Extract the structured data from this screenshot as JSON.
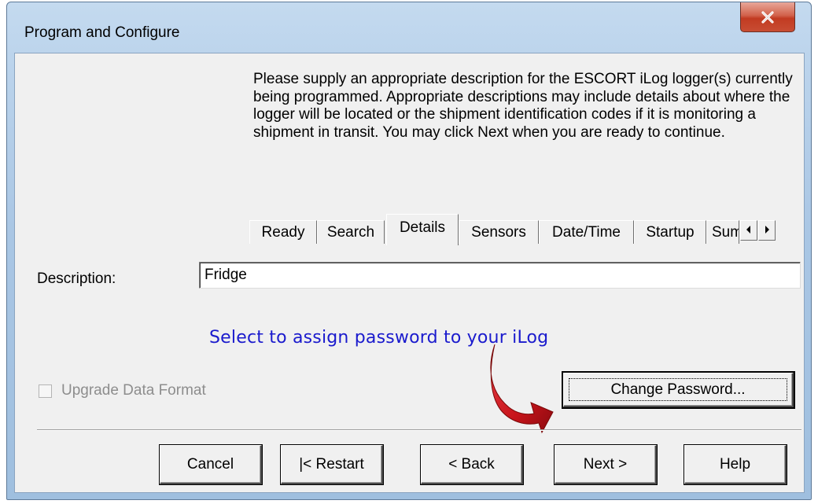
{
  "window": {
    "title": "Program and Configure",
    "close_label": "close"
  },
  "instructions": "Please supply an appropriate description for the ESCORT iLog logger(s) currently being programmed. Appropriate descriptions may include details about where the logger will be located or the shipment identification codes if it is monitoring a shipment in transit. You may click Next when you are ready to continue.",
  "tabs": [
    {
      "label": "Ready",
      "active": false
    },
    {
      "label": "Search",
      "active": false
    },
    {
      "label": "Details",
      "active": true
    },
    {
      "label": "Sensors",
      "active": false
    },
    {
      "label": "Date/Time",
      "active": false
    },
    {
      "label": "Startup",
      "active": false
    },
    {
      "label": "Sum",
      "active": false
    }
  ],
  "description": {
    "label": "Description:",
    "value": "Fridge"
  },
  "annotation": "Select to assign password to your iLog",
  "upgrade": {
    "label": "Upgrade Data Format",
    "checked": false,
    "enabled": false
  },
  "change_password_label": "Change Password...",
  "buttons": {
    "cancel": "Cancel",
    "restart": "|< Restart",
    "back": "< Back",
    "next": "Next >",
    "help": "Help"
  },
  "colors": {
    "annotation": "#1a1acd",
    "arrow": "#c8141a",
    "close_button": "#c23b22"
  },
  "icons": [
    "close-icon",
    "tab-scroll-left-icon",
    "tab-scroll-right-icon",
    "pointer-arrow-icon"
  ]
}
